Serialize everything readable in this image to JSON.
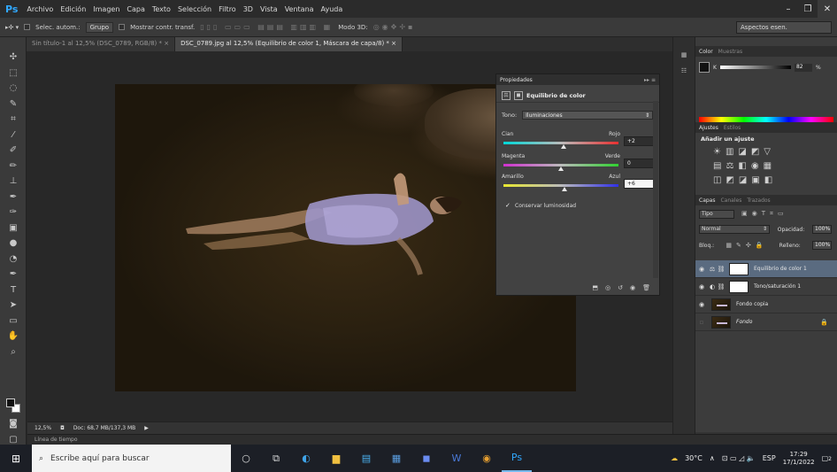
{
  "app": {
    "logo": "Ps",
    "menu": [
      "Archivo",
      "Edición",
      "Imagen",
      "Capa",
      "Texto",
      "Selección",
      "Filtro",
      "3D",
      "Vista",
      "Ventana",
      "Ayuda"
    ],
    "window_controls": [
      "–",
      "❐",
      "✕"
    ]
  },
  "options_bar": {
    "auto_select_label": "Selec. autom.:",
    "group_value": "Grupo",
    "show_transform_label": "Mostrar contr. transf.",
    "mode3d_label": "Modo 3D:",
    "workspace": "Aspectos esen."
  },
  "tabs": [
    {
      "label": "Sin título-1 al 12,5% (DSC_0789, RGB/8) *",
      "close": "×"
    },
    {
      "label": "DSC_0789.jpg al 12,5% (Equilibrio de color 1, Máscara de capa/8) *",
      "close": "×"
    }
  ],
  "properties": {
    "title": "Propiedades",
    "adjustment_name": "Equilibrio de color",
    "tone_label": "Tono:",
    "tone_value": "Iluminaciones",
    "sliders": [
      {
        "left": "Cian",
        "right": "Rojo",
        "value": "+2",
        "fraction": 0.52,
        "colors": [
          "#00d8d8",
          "#e83030"
        ]
      },
      {
        "left": "Magenta",
        "right": "Verde",
        "value": "0",
        "fraction": 0.5,
        "colors": [
          "#d030d0",
          "#30d030"
        ]
      },
      {
        "left": "Amarillo",
        "right": "Azul",
        "value": "+6",
        "fraction": 0.53,
        "colors": [
          "#e8e830",
          "#3030e8"
        ]
      }
    ],
    "preserve_label": "Conservar luminosidad",
    "preserve_checked": "✓"
  },
  "color_panel": {
    "tabs": [
      "Color",
      "Muestras"
    ],
    "channel_label": "K",
    "channel_value": "82",
    "pct": "%"
  },
  "adjust_panel": {
    "tabs": [
      "Ajustes",
      "Estilos"
    ],
    "heading": "Añadir un ajuste"
  },
  "layers_panel": {
    "tabs": [
      "Capas",
      "Canales",
      "Trazados"
    ],
    "filter_value": "Tipo",
    "blend_mode": "Normal",
    "opacity_label": "Opacidad:",
    "opacity_value": "100%",
    "lock_label": "Bloq.:",
    "fill_label": "Relleno:",
    "fill_value": "100%",
    "layers": [
      {
        "name": "Equilibrio de color 1",
        "selected": true,
        "type": "adjust"
      },
      {
        "name": "Tono/saturación 1",
        "selected": false,
        "type": "adjust"
      },
      {
        "name": "Fondo copia",
        "selected": false,
        "type": "photo"
      },
      {
        "name": "Fondo",
        "selected": false,
        "type": "photo",
        "locked": true
      }
    ]
  },
  "status": {
    "zoom": "12,5%",
    "doc": "Doc: 68,7 MB/137,3 MB",
    "timeline": "Línea de tiempo"
  },
  "taskbar": {
    "search_placeholder": "Escribe aquí para buscar",
    "weather": "30°C",
    "lang": "ESP",
    "time": "17:29",
    "date": "17/1/2022",
    "notifications": "2"
  }
}
